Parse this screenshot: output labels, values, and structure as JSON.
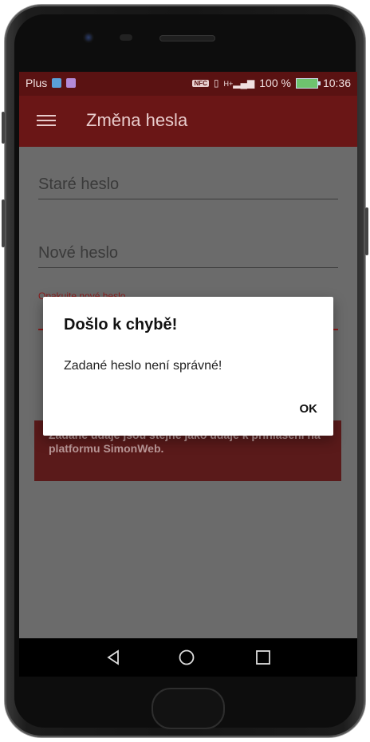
{
  "status_bar": {
    "carrier": "Plus",
    "nfc": "NFC",
    "signal_label": "H+",
    "battery_percent": "100 %",
    "time": "10:36",
    "colors": {
      "bg": "#5a1212"
    }
  },
  "app_bar": {
    "title": "Změna hesla",
    "menu_icon": "hamburger-icon"
  },
  "form": {
    "old_password_placeholder": "Staré heslo",
    "new_password_placeholder": "Nové heslo",
    "repeat_password_label": "Opakujte nové heslo"
  },
  "info_text": "Zadané údaje jsou stejné jako údaje k přihlášení na platformu SimonWeb.",
  "dialog": {
    "title": "Došlo k chybě!",
    "message": "Zadané heslo není správné!",
    "ok_label": "OK"
  },
  "nav": {
    "back_icon": "back-triangle-icon",
    "home_icon": "home-circle-icon",
    "recent_icon": "recent-square-icon"
  }
}
